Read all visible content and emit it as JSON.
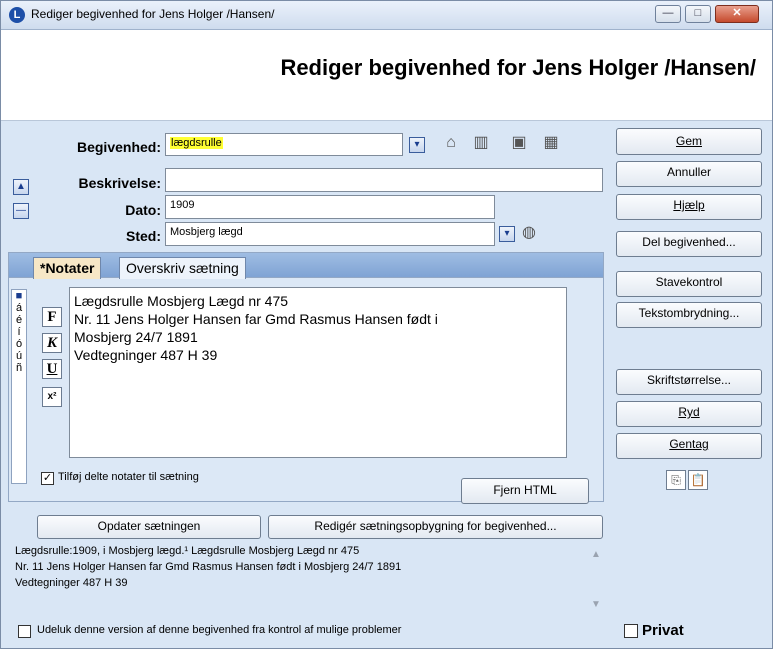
{
  "window": {
    "title": "Rediger begivenhed for Jens Holger /Hansen/",
    "app_icon_letter": "L",
    "controls": {
      "minimize": "—",
      "maximize": "□",
      "close": "✕"
    }
  },
  "header": {
    "title": "Rediger begivenhed for Jens Holger /Hansen/"
  },
  "form": {
    "event_label": "Begivenhed:",
    "event_value": "lægdsrulle",
    "description_label": "Beskrivelse:",
    "description_value": "",
    "date_label": "Dato:",
    "date_value": "1909",
    "place_label": "Sted:",
    "place_value": "Mosbjerg lægd"
  },
  "tabs": [
    {
      "label": "*Notater"
    },
    {
      "label": "Overskriv sætning"
    }
  ],
  "special_chars": [
    "á",
    "é",
    "í",
    "ó",
    "ú",
    "ñ"
  ],
  "format_buttons": {
    "bold": "F",
    "italic": "K",
    "underline": "U",
    "superscript": "x²"
  },
  "notes": {
    "lines": [
      "Lægdsrulle Mosbjerg Lægd nr 475",
      "Nr. 11 Jens Holger Hansen far Gmd Rasmus Hansen født i",
      "Mosbjerg 24/7 1891",
      "Vedtegninger 487 H 39"
    ],
    "shared_notes_label": "Tilføj delte notater til sætning",
    "shared_notes_checked": true,
    "remove_html_button": "Fjern HTML"
  },
  "sentence_buttons": {
    "update": "Opdater sætningen",
    "edit_structure": "Redigér sætningsopbygning for begivenhed..."
  },
  "sentence_preview": [
    "Lægdsrulle:1909, i Mosbjerg lægd.¹ Lægdsrulle Mosbjerg Lægd nr 475",
    "Nr. 11 Jens Holger Hansen far Gmd Rasmus Hansen født i Mosbjerg 24/7 1891",
    "Vedtegninger 487 H 39"
  ],
  "right_buttons": {
    "save": "Gem",
    "cancel": "Annuller",
    "help": "Hjælp",
    "share": "Del begivenhed...",
    "spellcheck": "Stavekontrol",
    "text_wrap": "Tekstombrydning...",
    "font_size": "Skriftstørrelse...",
    "clear": "Ryd",
    "repeat": "Gentag"
  },
  "bottom": {
    "exclude_label": "Udeluk denne version af denne begivenhed fra kontrol af mulige problemer",
    "exclude_checked": false,
    "private_label": "Privat",
    "private_checked": false
  },
  "colors": {
    "highlight": "#ffff33",
    "tab_active": "#f7e7c6",
    "window_bg": "#d9e6f5"
  }
}
